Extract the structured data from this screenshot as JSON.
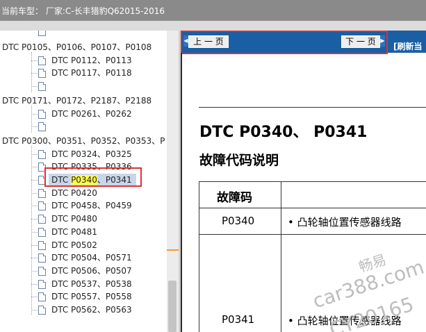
{
  "title_bar": {
    "text": "当前车型： 厂家:C-长丰猎豹Q62015-2016"
  },
  "tree": {
    "groups": [
      {
        "label": "DTC P0105、P0106、P0107、P0108",
        "items": [
          "DTC P0112、P0113",
          "DTC P0117、P0118"
        ]
      },
      {
        "label": "DTC P0171、P0172、P2187、P2188",
        "items": [
          "DTC P0261、P0262"
        ]
      },
      {
        "label": "DTC P0300、P0351、P0352、P0353、P",
        "items": [
          "DTC P0324、P0325",
          "DTC P0335、P0336",
          {
            "prefix": "DTC ",
            "highlight": "P0340",
            "suffix": "、P0341",
            "selected": true
          },
          "DTC P0420",
          "DTC P0458、P0459",
          "DTC P0480",
          "DTC P0481",
          "DTC P0502",
          "DTC P0504、P0571",
          "DTC P0506、P0507",
          "DTC P0537、P0538",
          "DTC P0557、P0558",
          "DTC P0562、P0563"
        ]
      }
    ]
  },
  "nav": {
    "prev_label": "上 一 页",
    "next_label": "下 一 页",
    "refresh_label": "[刷新当"
  },
  "document": {
    "heading": "DTC P0340、 P0341",
    "subheading": "故障代码说明",
    "table": {
      "headers": [
        "故障码",
        "说"
      ],
      "rows": [
        {
          "code": "P0340",
          "desc": "•  凸轮轴位置传感器线路"
        },
        {
          "code": "P0341",
          "desc": "•  凸轮轴位置传感器线路"
        }
      ]
    },
    "watermark": [
      "畅易",
      "car388.com",
      "CY20165"
    ]
  },
  "colors": {
    "nav_bar": "#1a5fa3",
    "highlight_box": "#e03030",
    "selection": "#c9d6ea",
    "text_highlight": "#ffff44"
  }
}
